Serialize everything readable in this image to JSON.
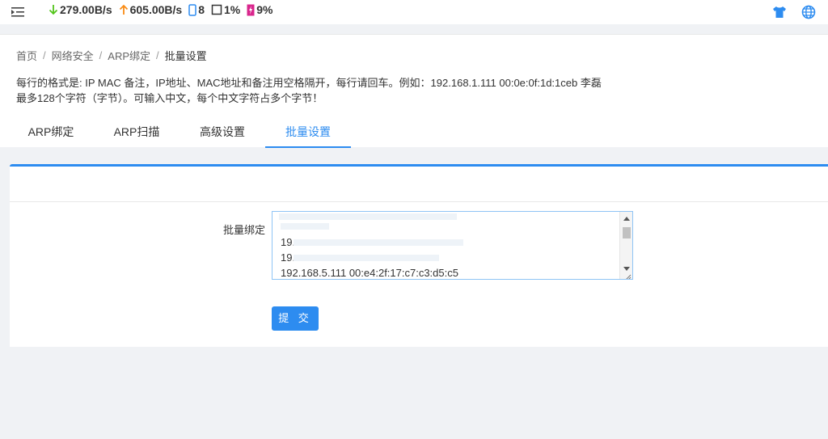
{
  "topbar": {
    "download": "279.00B/s",
    "upload": "605.00B/s",
    "devices": "8",
    "cpu": "1%",
    "memory": "9%"
  },
  "breadcrumb": {
    "home": "首页",
    "section": "网络安全",
    "page": "ARP绑定",
    "current": "批量设置"
  },
  "description": {
    "line1": "每行的格式是: IP MAC 备注，IP地址、MAC地址和备注用空格隔开，每行请回车。例如：192.168.1.111 00:0e:0f:1d:1ceb 李磊",
    "line2": "最多128个字符（字节）。可输入中文，每个中文字符占多个字节！"
  },
  "tabs": [
    {
      "label": "ARP绑定"
    },
    {
      "label": "ARP扫描"
    },
    {
      "label": "高级设置"
    },
    {
      "label": "批量设置"
    }
  ],
  "form": {
    "label": "批量绑定",
    "lines": [
      "19.",
      "19.",
      "192.168.5.111 00:e4:2f:17:c7:c3:d5:c5"
    ],
    "submit": "提 交"
  },
  "colors": {
    "accent": "#2d8cf0",
    "download_arrow": "#52c41a",
    "upload_arrow": "#fa8c16",
    "memory_badge": "#d9268d"
  }
}
